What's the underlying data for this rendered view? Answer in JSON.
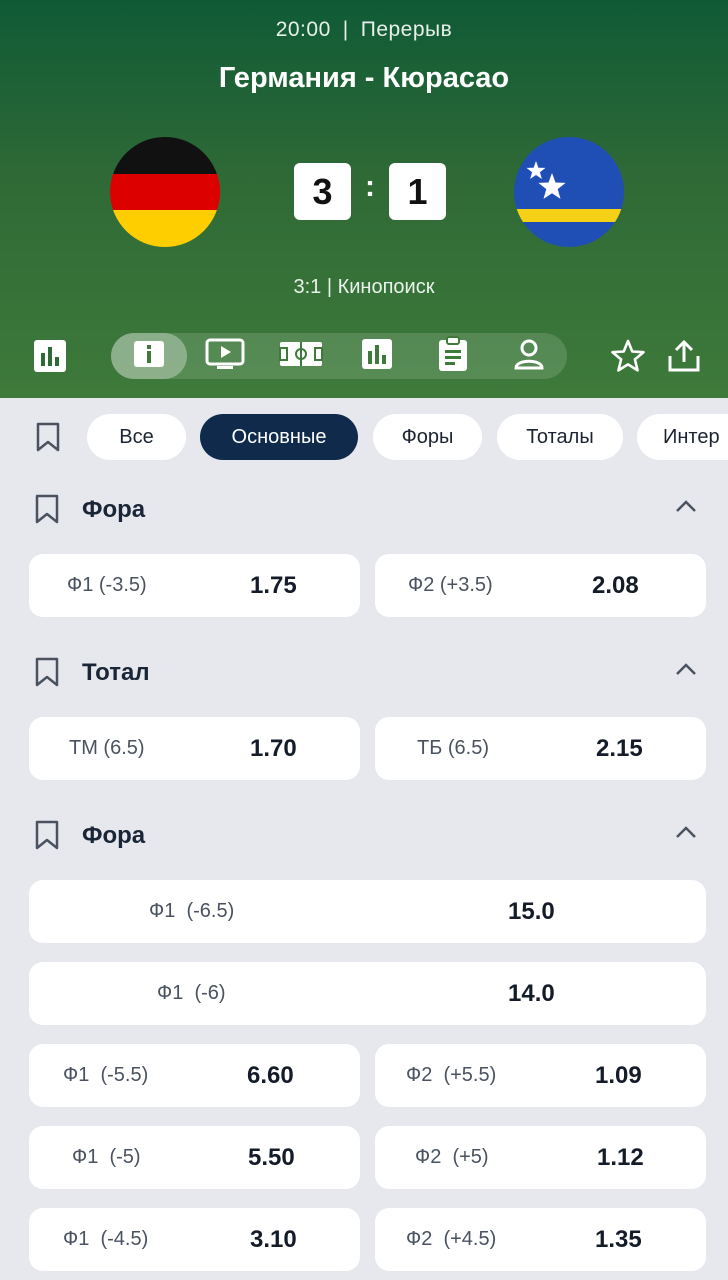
{
  "header": {
    "time": "20:00",
    "separator": "|",
    "period": "Перерыв",
    "title": "Германия - Кюрасао",
    "score_home": "3",
    "score_colon": ":",
    "score_away": "1",
    "broadcast": "3:1 | Кинопоиск"
  },
  "filters": {
    "chips": [
      "Все",
      "Основные",
      "Форы",
      "Тоталы",
      "Интер"
    ],
    "active": "Основные"
  },
  "sections": [
    {
      "title": "Фора",
      "rows": [
        [
          {
            "label": "Ф1 (-3.5)",
            "odd": "1.75"
          },
          {
            "label": "Ф2 (+3.5)",
            "odd": "2.08"
          }
        ]
      ]
    },
    {
      "title": "Тотал",
      "rows": [
        [
          {
            "label": "ТМ (6.5)",
            "odd": "1.70"
          },
          {
            "label": "ТБ (6.5)",
            "odd": "2.15"
          }
        ]
      ]
    },
    {
      "title": "Фора",
      "rows": [
        [
          {
            "label": "Ф1  (-6.5)",
            "odd": "15.0"
          }
        ],
        [
          {
            "label": "Ф1  (-6)",
            "odd": "14.0"
          }
        ],
        [
          {
            "label": "Ф1  (-5.5)",
            "odd": "6.60"
          },
          {
            "label": "Ф2  (+5.5)",
            "odd": "1.09"
          }
        ],
        [
          {
            "label": "Ф1  (-5)",
            "odd": "5.50"
          },
          {
            "label": "Ф2  (+5)",
            "odd": "1.12"
          }
        ],
        [
          {
            "label": "Ф1  (-4.5)",
            "odd": "3.10"
          },
          {
            "label": "Ф2  (+4.5)",
            "odd": "1.35"
          }
        ]
      ]
    }
  ],
  "icons": {
    "stats_left": "bar-chart-icon",
    "tabs": [
      "info-icon",
      "video-icon",
      "field-icon",
      "stats-icon",
      "clipboard-icon",
      "lineup-icon"
    ],
    "favorite": "star-icon",
    "share": "share-icon"
  },
  "colors": {
    "hero_top": "#0f5a36",
    "hero_bottom": "#3e7a3a",
    "active_chip": "#0f2a4a",
    "page_bg": "#e6e8ed"
  }
}
